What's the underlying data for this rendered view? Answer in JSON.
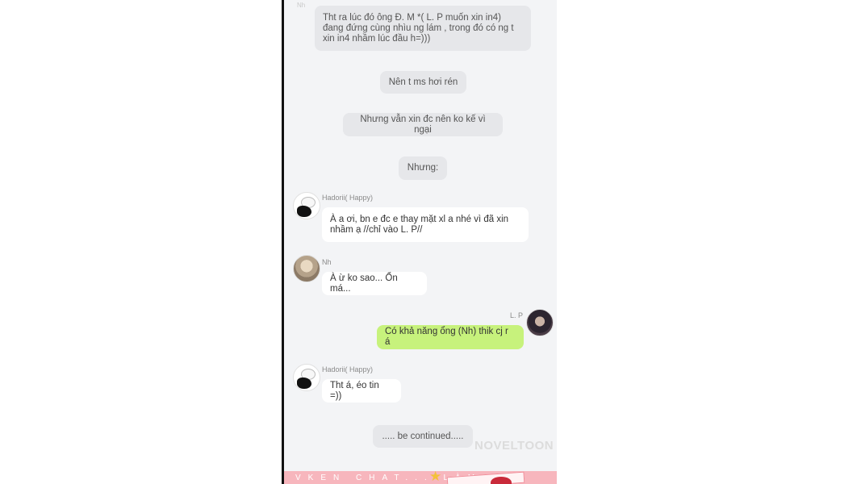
{
  "top_faint_label": "Nh",
  "messages": {
    "narr1": "Tht ra lúc đó ông Đ. M *( L. P muốn xin in4) đang đứng cùng nhìu ng lám , trong đó có ng t xin in4 nhầm lúc đầu h=)))",
    "narr2": "Nên t ms hơi rén",
    "narr3": "Nhưng vẫn xin đc nên ko kế vì ngại",
    "narr4": "Nhưng:",
    "m1_sender": "Hadorii( Happy)",
    "m1_text": "À a ơi, bn e đc e thay mặt xl a nhé vì đã xin nhầm ạ //chỉ vào L. P//",
    "m2_sender": "Nh",
    "m2_text": "À ừ ko sao... Ổn má...",
    "m3_sender": "L. P",
    "m3_text": "Có khả năng ổng (Nh) thik cj r á",
    "m4_sender": "Hadorii( Happy)",
    "m4_text": "Tht á, éo tin =))",
    "narr5": "..... be continued....."
  },
  "watermark": "NOVELTOON",
  "banner_text": "VKEN CHAT... LÀM PHÁ",
  "colors": {
    "chat_bg": "#f3f4f6",
    "narration_bubble": "#e6e7ea",
    "incoming_bubble": "#ffffff",
    "outgoing_bubble": "#c7f27c",
    "banner": "#f7b6bd"
  },
  "icons": {
    "avatar_hadorii": "anime-avatar-white-hair",
    "avatar_nh": "anime-avatar-brown-hair",
    "avatar_lp": "anime-avatar-dark-hair",
    "banner_star": "star-icon"
  }
}
